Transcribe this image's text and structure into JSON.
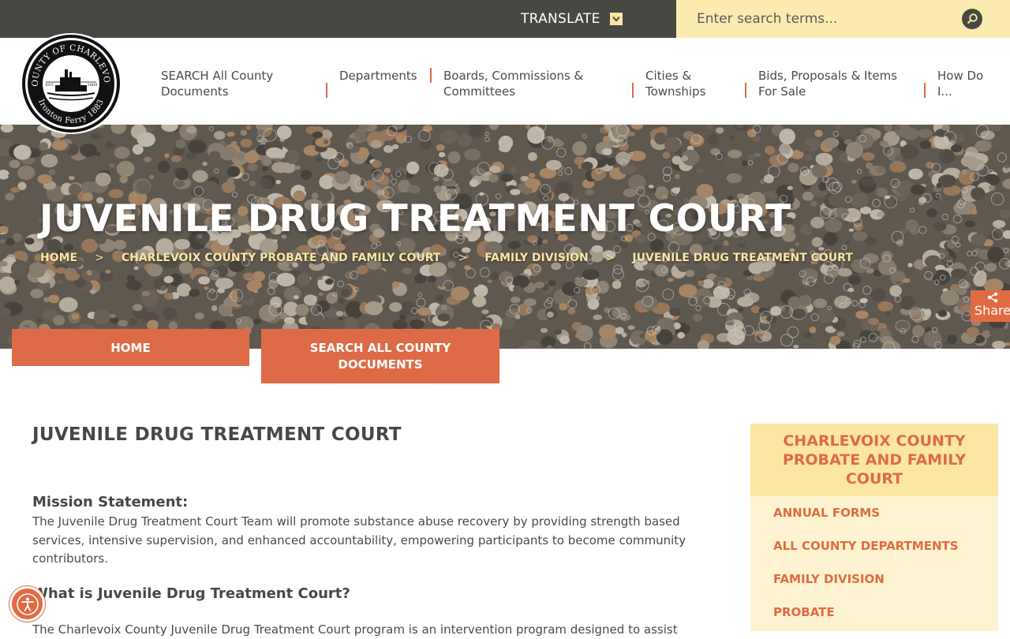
{
  "topbar": {
    "translate_label": "TRANSLATE",
    "search_placeholder": "Enter search terms...",
    "icons": {
      "translate": "chevron-down-icon",
      "search": "search-icon"
    }
  },
  "logo": {
    "ring_text_top": "COUNTY OF CHARLEVOIX",
    "ring_text_bottom": "Ironton Ferry 1883",
    "est": "EST.",
    "year": "1869"
  },
  "nav": [
    {
      "label": "SEARCH All County Documents"
    },
    {
      "label": "Departments"
    },
    {
      "label": "Boards, Commissions & Committees"
    },
    {
      "label": "Cities & Townships"
    },
    {
      "label": "Bids, Proposals & Items For Sale"
    },
    {
      "label": "How Do I..."
    }
  ],
  "hero": {
    "title": "JUVENILE DRUG TREATMENT COURT",
    "breadcrumb": [
      "HOME",
      "CHARLEVOIX COUNTY PROBATE AND FAMILY COURT",
      "FAMILY DIVISION",
      "JUVENILE DRUG TREATMENT COURT"
    ],
    "breadcrumb_sep": ">"
  },
  "share": {
    "label": "Share",
    "icon": "share-icon"
  },
  "buttons": {
    "home": "HOME",
    "search_docs": "SEARCH ALL COUNTY DOCUMENTS"
  },
  "main": {
    "title": "JUVENILE DRUG TREATMENT COURT",
    "mission_heading": "Mission Statement:",
    "mission_text": "The Juvenile Drug Treatment Court Team will promote substance abuse recovery by providing strength based services, intensive supervision, and enhanced accountability, empowering participants to become community contributors.",
    "what_heading": "What is Juvenile Drug Treatment Court?",
    "what_text": "The Charlevoix County Juvenile Drug Treatment Court program is an intervention program designed to assist"
  },
  "sidebar": {
    "heading": "CHARLEVOIX COUNTY PROBATE AND FAMILY COURT",
    "links": [
      "ANNUAL FORMS",
      "ALL COUNTY DEPARTMENTS",
      "FAMILY DIVISION",
      "PROBATE"
    ]
  },
  "colors": {
    "accent": "#e06b43",
    "dark": "#474842",
    "cream": "#fbe7a3",
    "cream_light": "#fdf3d0"
  },
  "accessibility": {
    "icon": "accessibility-icon"
  }
}
